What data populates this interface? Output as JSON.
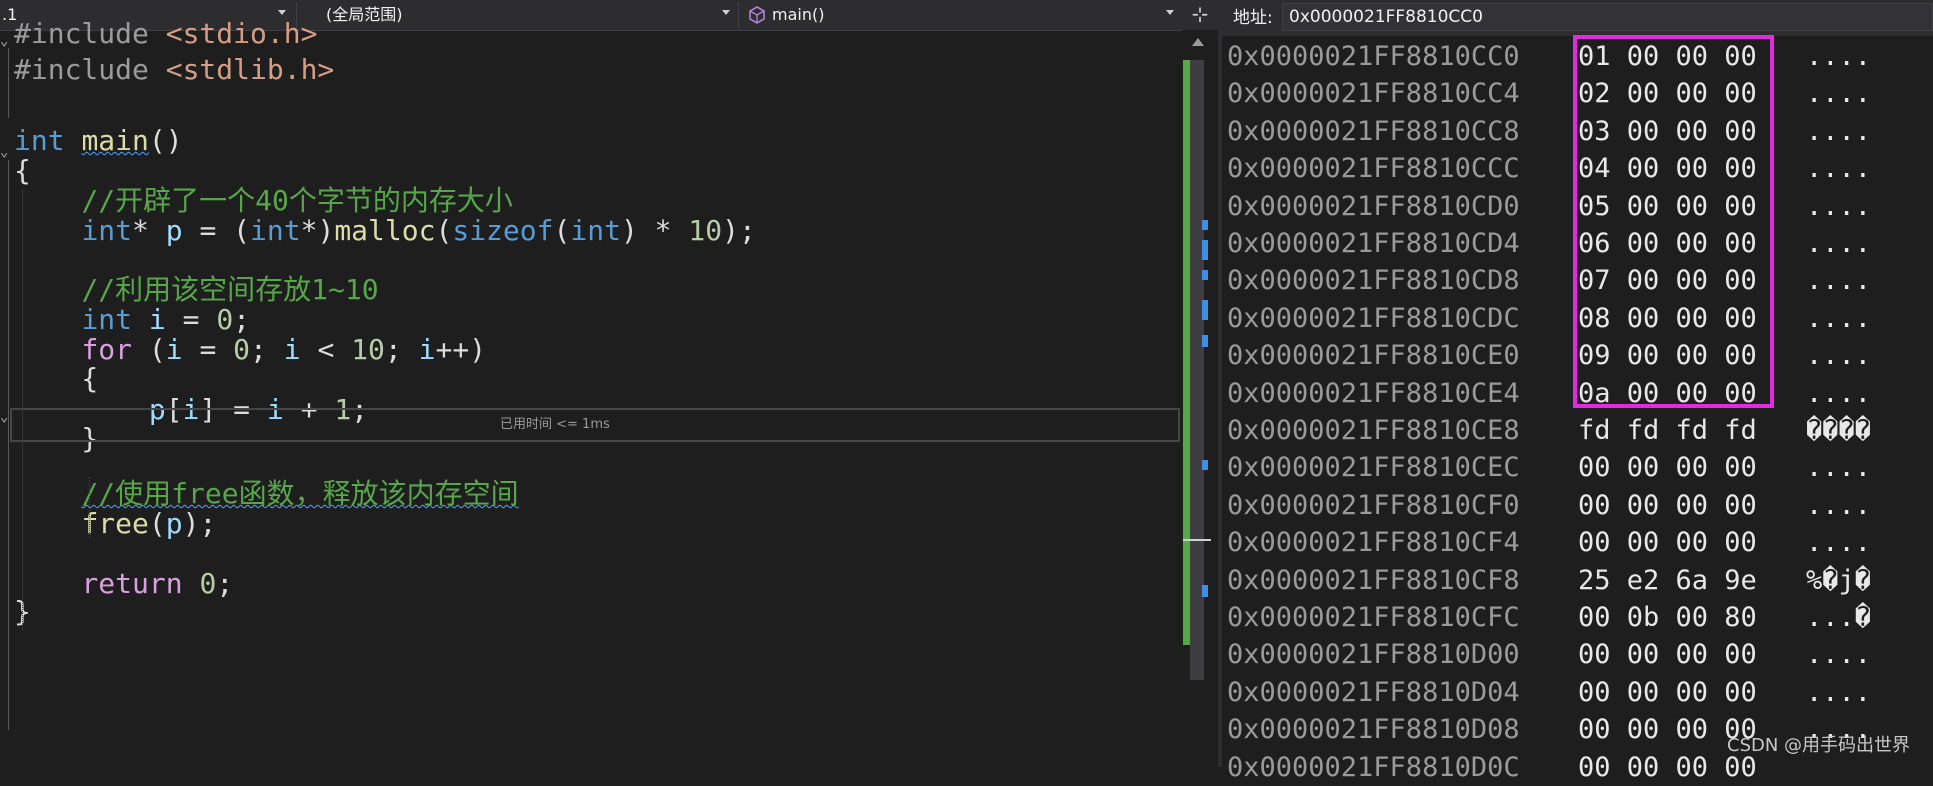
{
  "navbar": {
    "project_fragment": ".1",
    "scope": "(全局范围)",
    "function": "main()",
    "split_button": "⊹"
  },
  "code": {
    "lines": [
      {
        "t": [
          [
            "pre",
            "#include "
          ],
          [
            "str",
            "<stdio.h>"
          ]
        ]
      },
      {
        "t": [
          [
            "pre",
            "#include "
          ],
          [
            "str",
            "<stdlib.h>"
          ]
        ]
      },
      {
        "t": []
      },
      {
        "t": [
          [
            "kw",
            "int "
          ],
          [
            "fn",
            "main"
          ],
          [
            "pl",
            "()"
          ]
        ]
      },
      {
        "t": [
          [
            "pl",
            "{"
          ]
        ]
      },
      {
        "t": [
          [
            "pl",
            "    "
          ],
          [
            "cmt",
            "//开辟了一个40个字节的内存大小"
          ]
        ]
      },
      {
        "t": [
          [
            "pl",
            "    "
          ],
          [
            "kw",
            "int"
          ],
          [
            "pl",
            "* "
          ],
          [
            "var",
            "p"
          ],
          [
            "pl",
            " = ("
          ],
          [
            "kw",
            "int"
          ],
          [
            "pl",
            "*)"
          ],
          [
            "fn",
            "malloc"
          ],
          [
            "pl",
            "("
          ],
          [
            "kw",
            "sizeof"
          ],
          [
            "pl",
            "("
          ],
          [
            "kw",
            "int"
          ],
          [
            "pl",
            ") * "
          ],
          [
            "num",
            "10"
          ],
          [
            "pl",
            ");"
          ]
        ]
      },
      {
        "t": []
      },
      {
        "t": [
          [
            "pl",
            "    "
          ],
          [
            "cmt",
            "//利用该空间存放1~10"
          ]
        ]
      },
      {
        "t": [
          [
            "pl",
            "    "
          ],
          [
            "kw",
            "int "
          ],
          [
            "var",
            "i"
          ],
          [
            "pl",
            " = "
          ],
          [
            "num",
            "0"
          ],
          [
            "pl",
            ";"
          ]
        ]
      },
      {
        "t": [
          [
            "pl",
            "    "
          ],
          [
            "ctl",
            "for"
          ],
          [
            "pl",
            " ("
          ],
          [
            "var",
            "i"
          ],
          [
            "pl",
            " = "
          ],
          [
            "num",
            "0"
          ],
          [
            "pl",
            "; "
          ],
          [
            "var",
            "i"
          ],
          [
            "pl",
            " < "
          ],
          [
            "num",
            "10"
          ],
          [
            "pl",
            "; "
          ],
          [
            "var",
            "i"
          ],
          [
            "pl",
            "++)"
          ]
        ]
      },
      {
        "t": [
          [
            "pl",
            "    {"
          ]
        ]
      },
      {
        "t": [
          [
            "pl",
            "        "
          ],
          [
            "var",
            "p"
          ],
          [
            "pl",
            "["
          ],
          [
            "var",
            "i"
          ],
          [
            "pl",
            "] = "
          ],
          [
            "var",
            "i"
          ],
          [
            "pl",
            " + "
          ],
          [
            "num",
            "1"
          ],
          [
            "pl",
            ";"
          ]
        ]
      },
      {
        "t": [
          [
            "pl",
            "    }"
          ]
        ]
      },
      {
        "t": []
      },
      {
        "t": [
          [
            "pl",
            "    "
          ],
          [
            "cmt",
            "//使用free函数，释放该内存空间"
          ]
        ]
      },
      {
        "t": [
          [
            "pl",
            "    "
          ],
          [
            "fn",
            "free"
          ],
          [
            "pl",
            "("
          ],
          [
            "var",
            "p"
          ],
          [
            "pl",
            ");"
          ]
        ]
      },
      {
        "t": []
      },
      {
        "t": [
          [
            "pl",
            "    "
          ],
          [
            "ctl",
            "return "
          ],
          [
            "num",
            "0"
          ],
          [
            "pl",
            ";"
          ]
        ]
      },
      {
        "t": [
          [
            "pl",
            "}"
          ]
        ]
      }
    ],
    "perf_tip": "已用时间 <= 1ms"
  },
  "memory": {
    "address_label": "地址:",
    "address_value": "0x0000021FF8810CC0",
    "rows": [
      {
        "addr": "0x0000021FF8810CC0",
        "hex": "01 00 00 00",
        "ascii": "...."
      },
      {
        "addr": "0x0000021FF8810CC4",
        "hex": "02 00 00 00",
        "ascii": "...."
      },
      {
        "addr": "0x0000021FF8810CC8",
        "hex": "03 00 00 00",
        "ascii": "...."
      },
      {
        "addr": "0x0000021FF8810CCC",
        "hex": "04 00 00 00",
        "ascii": "...."
      },
      {
        "addr": "0x0000021FF8810CD0",
        "hex": "05 00 00 00",
        "ascii": "...."
      },
      {
        "addr": "0x0000021FF8810CD4",
        "hex": "06 00 00 00",
        "ascii": "...."
      },
      {
        "addr": "0x0000021FF8810CD8",
        "hex": "07 00 00 00",
        "ascii": "...."
      },
      {
        "addr": "0x0000021FF8810CDC",
        "hex": "08 00 00 00",
        "ascii": "...."
      },
      {
        "addr": "0x0000021FF8810CE0",
        "hex": "09 00 00 00",
        "ascii": "...."
      },
      {
        "addr": "0x0000021FF8810CE4",
        "hex": "0a 00 00 00",
        "ascii": "...."
      },
      {
        "addr": "0x0000021FF8810CE8",
        "hex": "fd fd fd fd",
        "ascii": "����"
      },
      {
        "addr": "0x0000021FF8810CEC",
        "hex": "00 00 00 00",
        "ascii": "...."
      },
      {
        "addr": "0x0000021FF8810CF0",
        "hex": "00 00 00 00",
        "ascii": "...."
      },
      {
        "addr": "0x0000021FF8810CF4",
        "hex": "00 00 00 00",
        "ascii": "...."
      },
      {
        "addr": "0x0000021FF8810CF8",
        "hex": "25 e2 6a 9e",
        "ascii": "%�j�"
      },
      {
        "addr": "0x0000021FF8810CFC",
        "hex": "00 0b 00 80",
        "ascii": "...�"
      },
      {
        "addr": "0x0000021FF8810D00",
        "hex": "00 00 00 00",
        "ascii": "...."
      },
      {
        "addr": "0x0000021FF8810D04",
        "hex": "00 00 00 00",
        "ascii": "...."
      },
      {
        "addr": "0x0000021FF8810D08",
        "hex": "00 00 00 00",
        "ascii": "...."
      },
      {
        "addr": "0x0000021FF8810D0C",
        "hex": "00 00 00 00",
        "ascii": ""
      }
    ]
  },
  "watermark": "CSDN @用手码出世界",
  "colors": {
    "highlight_box": "#e32ae0",
    "keyword": "#569cd6",
    "comment": "#57a64a",
    "change_bar": "#57a64a"
  }
}
